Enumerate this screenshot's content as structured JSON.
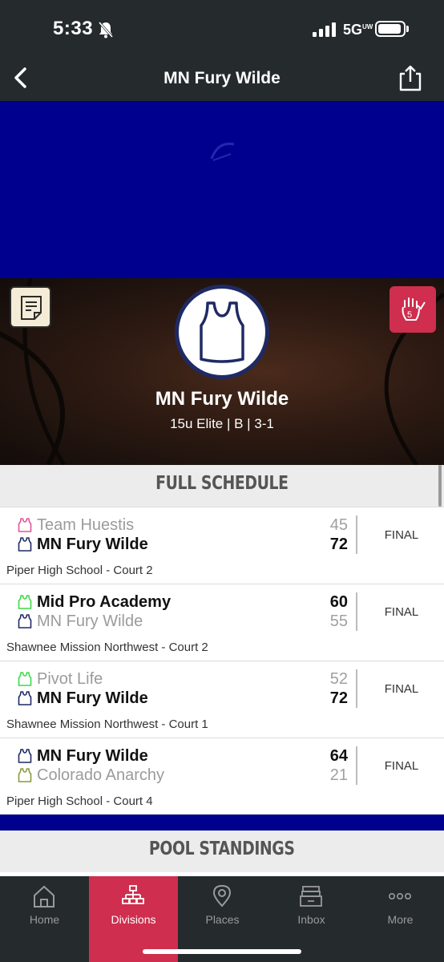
{
  "status_bar": {
    "time": "5:33",
    "network": "5G",
    "network_sup": "UW"
  },
  "nav": {
    "title": "MN Fury Wilde"
  },
  "team": {
    "name": "MN Fury Wilde",
    "subtitle": "15u Elite | B | 3-1"
  },
  "schedule": {
    "header": "FULL SCHEDULE",
    "games": [
      {
        "team1": "Team Huestis",
        "team1_color": "#e0559a",
        "score1": "45",
        "team2": "MN Fury Wilde",
        "team2_color": "#1f2a64",
        "score2": "72",
        "winner": 2,
        "status": "FINAL",
        "venue": "Piper High School - Court 2"
      },
      {
        "team1": "Mid Pro Academy",
        "team1_color": "#3ed94a",
        "score1": "60",
        "team2": "MN Fury Wilde",
        "team2_color": "#1f2a64",
        "score2": "55",
        "winner": 1,
        "status": "FINAL",
        "venue": "Shawnee Mission Northwest - Court 2"
      },
      {
        "team1": "Pivot Life",
        "team1_color": "#3ed94a",
        "score1": "52",
        "team2": "MN Fury Wilde",
        "team2_color": "#1f2a64",
        "score2": "72",
        "winner": 2,
        "status": "FINAL",
        "venue": "Shawnee Mission Northwest - Court 1"
      },
      {
        "team1": "MN Fury Wilde",
        "team1_color": "#1f2a64",
        "score1": "64",
        "team2": "Colorado Anarchy",
        "team2_color": "#8a9a3a",
        "score2": "21",
        "winner": 1,
        "status": "FINAL",
        "venue": "Piper High School - Court 4"
      }
    ]
  },
  "standings": {
    "header": "POOL STANDINGS"
  },
  "tabbar": {
    "active": "Divisions",
    "tabs": [
      {
        "label": "Home",
        "icon": "home-icon"
      },
      {
        "label": "Divisions",
        "icon": "bracket-icon"
      },
      {
        "label": "Places",
        "icon": "map-pin-icon"
      },
      {
        "label": "Inbox",
        "icon": "inbox-icon"
      },
      {
        "label": "More",
        "icon": "more-dots-icon"
      }
    ]
  },
  "colors": {
    "brand_red": "#cf2e4e",
    "navy": "#00008f",
    "dark": "#252a2d"
  }
}
